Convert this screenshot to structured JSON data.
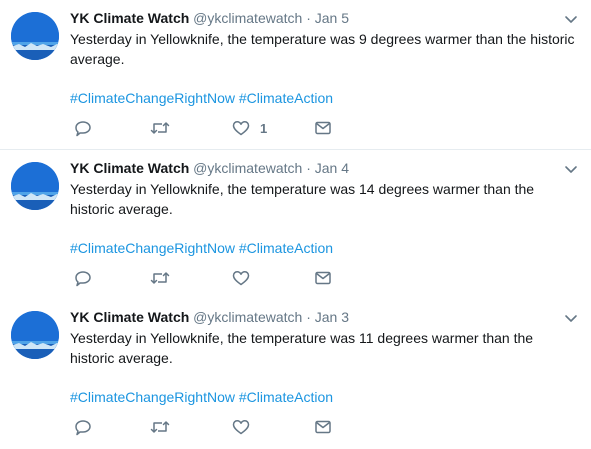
{
  "tweets": [
    {
      "name": "YK Climate Watch",
      "handle": "@ykclimatewatch",
      "separator": "·",
      "date": "Jan 5",
      "text": "Yesterday in Yellowknife, the temperature was 9 degrees warmer than the historic average.",
      "hashtags": [
        "#ClimateChangeRightNow",
        "#ClimateAction"
      ],
      "likes": "1"
    },
    {
      "name": "YK Climate Watch",
      "handle": "@ykclimatewatch",
      "separator": "·",
      "date": "Jan 4",
      "text": "Yesterday in Yellowknife, the temperature was 14 degrees warmer than the historic average.",
      "hashtags": [
        "#ClimateChangeRightNow",
        "#ClimateAction"
      ],
      "likes": ""
    },
    {
      "name": "YK Climate Watch",
      "handle": "@ykclimatewatch",
      "separator": "·",
      "date": "Jan 3",
      "text": "Yesterday in Yellowknife, the temperature was 11 degrees warmer than the historic average.",
      "hashtags": [
        "#ClimateChangeRightNow",
        "#ClimateAction"
      ],
      "likes": ""
    }
  ],
  "icons": {
    "caret": "chevron-down-icon",
    "reply": "reply-icon",
    "retweet": "retweet-icon",
    "like": "heart-icon",
    "dm": "envelope-icon"
  },
  "colors": {
    "name": "#14171a",
    "muted": "#657786",
    "link": "#1b95e0",
    "divider": "#e6ecf0",
    "avatar": "#1c6fd6"
  }
}
